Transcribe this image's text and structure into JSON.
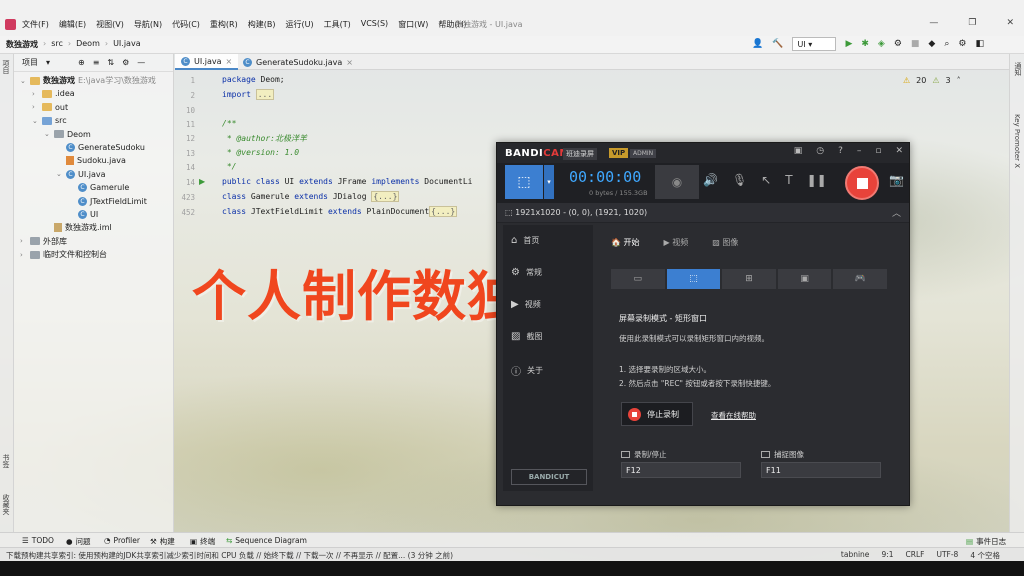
{
  "ide": {
    "window_title": "数独游戏 - UI.java",
    "menu": [
      "文件(F)",
      "编辑(E)",
      "视图(V)",
      "导航(N)",
      "代码(C)",
      "重构(R)",
      "构建(B)",
      "运行(U)",
      "工具(T)",
      "VCS(S)",
      "窗口(W)",
      "帮助(H)"
    ],
    "window_controls": [
      "—",
      "❐",
      "✕"
    ],
    "breadcrumb": [
      "数独游戏",
      "src",
      "Deom",
      "UI.java"
    ],
    "run_config": "UI",
    "left_tabs": [
      "项目",
      "书签",
      "收藏夹"
    ],
    "right_tabs": [
      "通知",
      "Key Promoter X"
    ],
    "project_panel": {
      "title": "项目",
      "tree": [
        {
          "label": "数独游戏",
          "extra": "E:\\java学习\\数独游戏",
          "icon": "folder",
          "indent": 0,
          "expanded": true
        },
        {
          "label": ".idea",
          "icon": "folder",
          "indent": 1,
          "expanded": false
        },
        {
          "label": "out",
          "icon": "folder",
          "indent": 1,
          "expanded": false
        },
        {
          "label": "src",
          "icon": "folder-blue",
          "indent": 1,
          "expanded": true
        },
        {
          "label": "Deom",
          "icon": "folder-gray",
          "indent": 2,
          "expanded": true
        },
        {
          "label": "GenerateSudoku",
          "icon": "class",
          "indent": 3
        },
        {
          "label": "Sudoku.java",
          "icon": "java",
          "indent": 3
        },
        {
          "label": "UI.java",
          "icon": "class",
          "indent": 3,
          "expanded": true
        },
        {
          "label": "Gamerule",
          "icon": "class",
          "indent": 4
        },
        {
          "label": "JTextFieldLimit",
          "icon": "class",
          "indent": 4
        },
        {
          "label": "UI",
          "icon": "class",
          "indent": 4
        },
        {
          "label": "数独游戏.iml",
          "icon": "file",
          "indent": 2
        },
        {
          "label": "外部库",
          "icon": "folder-gray",
          "indent": 0,
          "expanded": false
        },
        {
          "label": "临时文件和控制台",
          "icon": "folder-gray",
          "indent": 0,
          "expanded": false
        }
      ]
    },
    "editor_tabs": [
      {
        "label": "UI.java",
        "active": true
      },
      {
        "label": "GenerateSudoku.java",
        "active": false
      }
    ],
    "inspections": {
      "warnings": "20",
      "weak": "3"
    },
    "code_lines": [
      {
        "num": "1",
        "text": "package Deom;"
      },
      {
        "num": "2",
        "text": "import ..."
      },
      {
        "num": "10",
        "text": ""
      },
      {
        "num": "11",
        "text": "/**"
      },
      {
        "num": "12",
        "text": " * @author:北极洋羊"
      },
      {
        "num": "13",
        "text": " * @version: 1.0"
      },
      {
        "num": "14",
        "text": " */"
      },
      {
        "num": "14",
        "text": "public class UI extends JFrame implements DocumentLi"
      },
      {
        "num": "423",
        "text": "class Gamerule extends JDialog {...}"
      },
      {
        "num": "452",
        "text": "class JTextFieldLimit extends PlainDocument{...}"
      }
    ],
    "bottom_tools": [
      "TODO",
      "问题",
      "Profiler",
      "构建",
      "终端",
      "Sequence Diagram"
    ],
    "event_log": "事件日志",
    "status_message": "下载预构建共享索引: 使用预构建的JDK共享索引减少索引时间和 CPU 负载 // 始终下载 // 下载一次 // 不再显示 // 配置... (3 分钟 之前)",
    "status_right": [
      "tabnine",
      "9:1",
      "CRLF",
      "UTF-8",
      "4 个空格"
    ]
  },
  "overlay_title": "个人制作数独小游戏",
  "bandicam": {
    "logo_main": "BANDI",
    "logo_accent": "CAM",
    "mode_label": "班迪录屏",
    "vip": "VIP",
    "admin": "ADMIN",
    "timer": "00:00:00",
    "bytes": "0 bytes / 155.3GB",
    "resolution": "1921x1020 - (0, 0), (1921, 1020)",
    "nav": [
      "首页",
      "常规",
      "视频",
      "截图",
      "关于"
    ],
    "subtabs": [
      "开始",
      "视频",
      "图像"
    ],
    "desc_title": "屏幕录制模式 - 矩形窗口",
    "desc": "使用此录制模式可以录制矩形窗口内的视频。",
    "step1": "1. 选择要录制的区域大小。",
    "step2": "2. 然后点击 \"REC\" 按钮或者按下录制快捷键。",
    "stop_button": "停止录制",
    "help_link": "查看在线帮助",
    "hotkey_rec_label": "录制/停止",
    "hotkey_rec_value": "F12",
    "hotkey_cap_label": "捕捉图像",
    "hotkey_cap_value": "F11",
    "bandicut": "BANDICUT"
  }
}
